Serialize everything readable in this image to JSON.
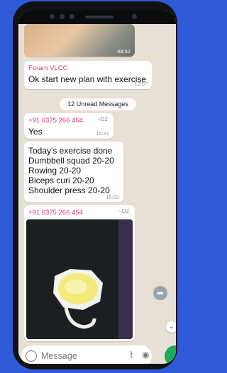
{
  "messages": {
    "m1_sender": "Foram VLCC",
    "m1_text": "Ok start new plan with exercise",
    "m1_time": "12:07",
    "m0_time": "09:52",
    "unread": "12 Unread Messages",
    "m2_sender": "+91 6375 266 454",
    "m2_tilde": "~D2",
    "m2_text": "Yes",
    "m2_time": "15:31",
    "m3_lines": [
      "Today's exercise done",
      "Dumbbell squad 20-20",
      "Rowing 20-20",
      "Biceps curi 20-20",
      "Shoulder press 20-20"
    ],
    "m3_time": "15:32",
    "m4_sender": "+91 6375 266 454",
    "m4_tilde": "~D2"
  },
  "input": {
    "placeholder": "Message"
  },
  "icons": [
    "emoji-icon",
    "attach-icon",
    "camera-icon",
    "mic-icon",
    "forward-icon",
    "scroll-down-icon"
  ]
}
